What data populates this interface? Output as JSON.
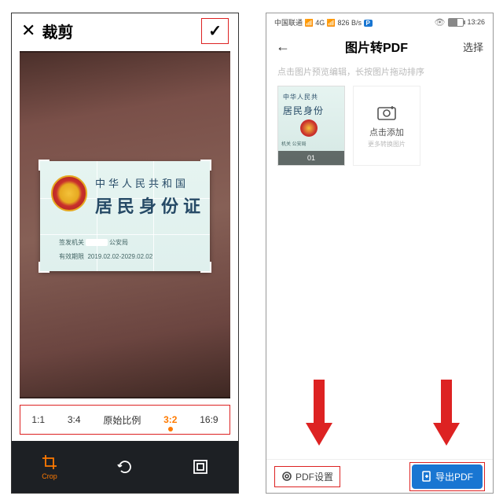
{
  "left": {
    "header": {
      "title": "裁剪"
    },
    "card": {
      "line1": "中华人民共和国",
      "line2": "居民身份证",
      "issuer_label": "签发机关",
      "issuer_value": "公安局",
      "valid_label": "有效期限",
      "valid_value": "2019.02.02-2029.02.02"
    },
    "ratios": [
      "1:1",
      "3:4",
      "原始比例",
      "3:2",
      "16:9"
    ],
    "selected_ratio_index": 3,
    "toolbar": {
      "crop": "Crop"
    }
  },
  "right": {
    "status": {
      "carrier": "中国联通",
      "net": "4G",
      "speed": "826 B/s",
      "time": "13:26"
    },
    "header": {
      "title": "图片转PDF",
      "select": "选择"
    },
    "tip": "点击图片预览编辑，长按图片拖动排序",
    "thumb": {
      "line1": "中华人民共",
      "line2": "居民身份",
      "meta": "机关       公安局",
      "index": "01"
    },
    "add": {
      "title": "点击添加",
      "sub": "更多转换图片"
    },
    "footer": {
      "settings": "PDF设置",
      "export": "导出PDF"
    }
  }
}
